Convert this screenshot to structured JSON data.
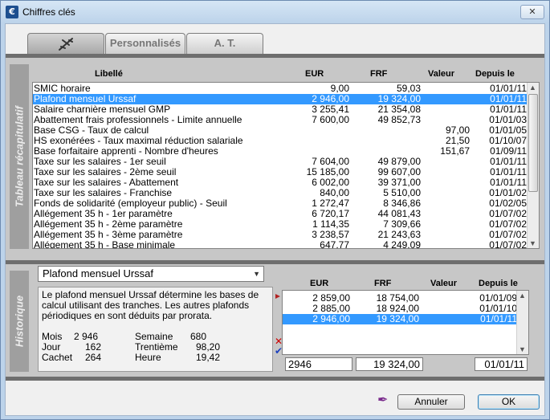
{
  "window": {
    "title": "Chiffres clés",
    "icon": "€",
    "close": "✕"
  },
  "tabs": [
    {
      "label": "",
      "icon": "airplane-icon"
    },
    {
      "label": "Personnalisés"
    },
    {
      "label": "A. T."
    }
  ],
  "recap": {
    "section_label": "Tableau récapitulatif",
    "headers": {
      "libelle": "Libellé",
      "eur": "EUR",
      "frf": "FRF",
      "valeur": "Valeur",
      "depuis": "Depuis le"
    },
    "selected_index": 1,
    "rows": [
      {
        "libelle": "SMIC horaire",
        "eur": "9,00",
        "frf": "59,03",
        "valeur": "",
        "depuis": "01/01/11"
      },
      {
        "libelle": "Plafond mensuel Urssaf",
        "eur": "2 946,00",
        "frf": "19 324,00",
        "valeur": "",
        "depuis": "01/01/11"
      },
      {
        "libelle": "Salaire charnière mensuel GMP",
        "eur": "3 255,41",
        "frf": "21 354,08",
        "valeur": "",
        "depuis": "01/01/11"
      },
      {
        "libelle": "Abattement frais professionnels - Limite annuelle",
        "eur": "7 600,00",
        "frf": "49 852,73",
        "valeur": "",
        "depuis": "01/01/03"
      },
      {
        "libelle": "Base CSG - Taux de calcul",
        "eur": "",
        "frf": "",
        "valeur": "97,00",
        "depuis": "01/01/05"
      },
      {
        "libelle": "HS exonérées - Taux maximal réduction salariale",
        "eur": "",
        "frf": "",
        "valeur": "21,50",
        "depuis": "01/10/07"
      },
      {
        "libelle": "Base forfaitaire apprenti - Nombre d'heures",
        "eur": "",
        "frf": "",
        "valeur": "151,67",
        "depuis": "01/09/11"
      },
      {
        "libelle": "Taxe sur les salaires - 1er seuil",
        "eur": "7 604,00",
        "frf": "49 879,00",
        "valeur": "",
        "depuis": "01/01/11"
      },
      {
        "libelle": "Taxe sur les salaires - 2ème seuil",
        "eur": "15 185,00",
        "frf": "99 607,00",
        "valeur": "",
        "depuis": "01/01/11"
      },
      {
        "libelle": "Taxe sur les salaires - Abattement",
        "eur": "6 002,00",
        "frf": "39 371,00",
        "valeur": "",
        "depuis": "01/01/11"
      },
      {
        "libelle": "Taxe sur les salaires - Franchise",
        "eur": "840,00",
        "frf": "5 510,00",
        "valeur": "",
        "depuis": "01/01/02"
      },
      {
        "libelle": "Fonds de solidarité (employeur public) - Seuil",
        "eur": "1 272,47",
        "frf": "8 346,86",
        "valeur": "",
        "depuis": "01/02/05"
      },
      {
        "libelle": "Allégement 35 h - 1er paramètre",
        "eur": "6 720,17",
        "frf": "44 081,43",
        "valeur": "",
        "depuis": "01/07/02"
      },
      {
        "libelle": "Allégement 35 h - 2ème paramètre",
        "eur": "1 114,35",
        "frf": "7 309,66",
        "valeur": "",
        "depuis": "01/07/02"
      },
      {
        "libelle": "Allégement 35 h - 3ème paramètre",
        "eur": "3 238,57",
        "frf": "21 243,63",
        "valeur": "",
        "depuis": "01/07/02"
      },
      {
        "libelle": "Allégement 35 h - Base minimale",
        "eur": "647,77",
        "frf": "4 249,09",
        "valeur": "",
        "depuis": "01/07/02"
      }
    ]
  },
  "history": {
    "section_label": "Historique",
    "combo_value": "Plafond mensuel Urssaf",
    "description": "Le plafond mensuel Urssaf détermine les bases de calcul utilisant des tranches. Les autres plafonds périodiques en sont déduits par prorata.",
    "stats": {
      "mois_label": "Mois",
      "mois_value": "2 946",
      "semaine_label": "Semaine",
      "semaine_value": "680",
      "jour_label": "Jour",
      "jour_value": "162",
      "trentieme_label": "Trentième",
      "trentieme_value": "98,20",
      "cachet_label": "Cachet",
      "cachet_value": "264",
      "heure_label": "Heure",
      "heure_value": "19,42"
    },
    "headers": {
      "eur": "EUR",
      "frf": "FRF",
      "valeur": "Valeur",
      "depuis": "Depuis le"
    },
    "rows": [
      {
        "eur": "2 859,00",
        "frf": "18 754,00",
        "depuis": "01/01/09"
      },
      {
        "eur": "2 885,00",
        "frf": "18 924,00",
        "depuis": "01/01/10"
      },
      {
        "eur": "2 946,00",
        "frf": "19 324,00",
        "depuis": "01/01/11"
      }
    ],
    "edit": {
      "eur": "2946",
      "frf": "19 324,00",
      "depuis": "01/01/11"
    }
  },
  "buttons": {
    "annuler": "Annuler",
    "ok": "OK"
  }
}
